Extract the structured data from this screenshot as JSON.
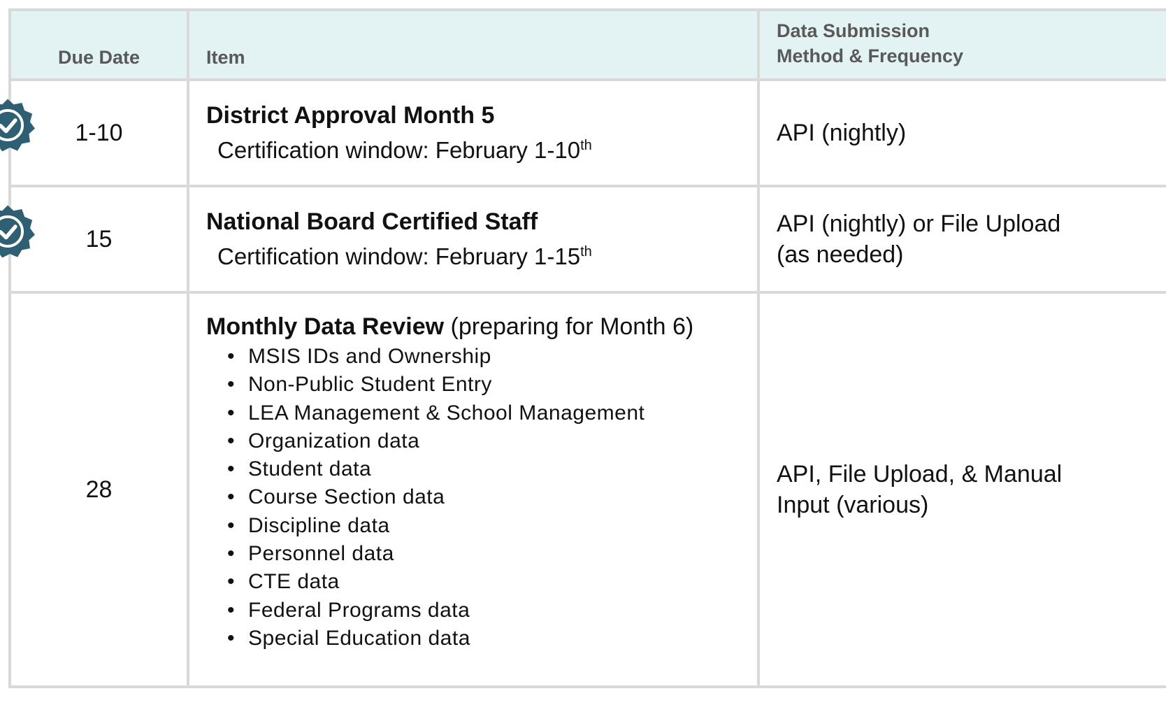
{
  "header": {
    "due_date": "Due Date",
    "item": "Item",
    "method_line1": "Data Submission",
    "method_line2": "Method & Frequency"
  },
  "rows": [
    {
      "due": "1-10",
      "checked": true,
      "title": "District Approval Month 5",
      "sub_prefix": "Certification window: February 1-10",
      "sub_sup": "th",
      "method": "API (nightly)"
    },
    {
      "due": "15",
      "checked": true,
      "title": "National Board Certified Staff",
      "sub_prefix": "Certification window: February 1-15",
      "sub_sup": "th",
      "method_line1": "API (nightly) or File Upload",
      "method_line2": "(as needed)"
    },
    {
      "due": "28",
      "checked": false,
      "title": "Monthly Data Review",
      "title_suffix": " (preparing for Month 6)",
      "bullet": "•",
      "items": [
        "MSIS IDs and Ownership",
        "Non-Public Student Entry",
        "LEA Management & School Management",
        "Organization data",
        "Student data",
        "Course Section data",
        "Discipline data",
        "Personnel data",
        "CTE data",
        "Federal Programs data",
        "Special Education data"
      ],
      "method_line1": "API, File Upload, & Manual",
      "method_line2": "Input (various)"
    }
  ],
  "colors": {
    "header_bg": "#e3f3f3",
    "header_text": "#595959",
    "border": "#d9d9d9",
    "badge": "#2f5f73"
  },
  "icons": {
    "badge": "verified-check-badge-icon"
  }
}
